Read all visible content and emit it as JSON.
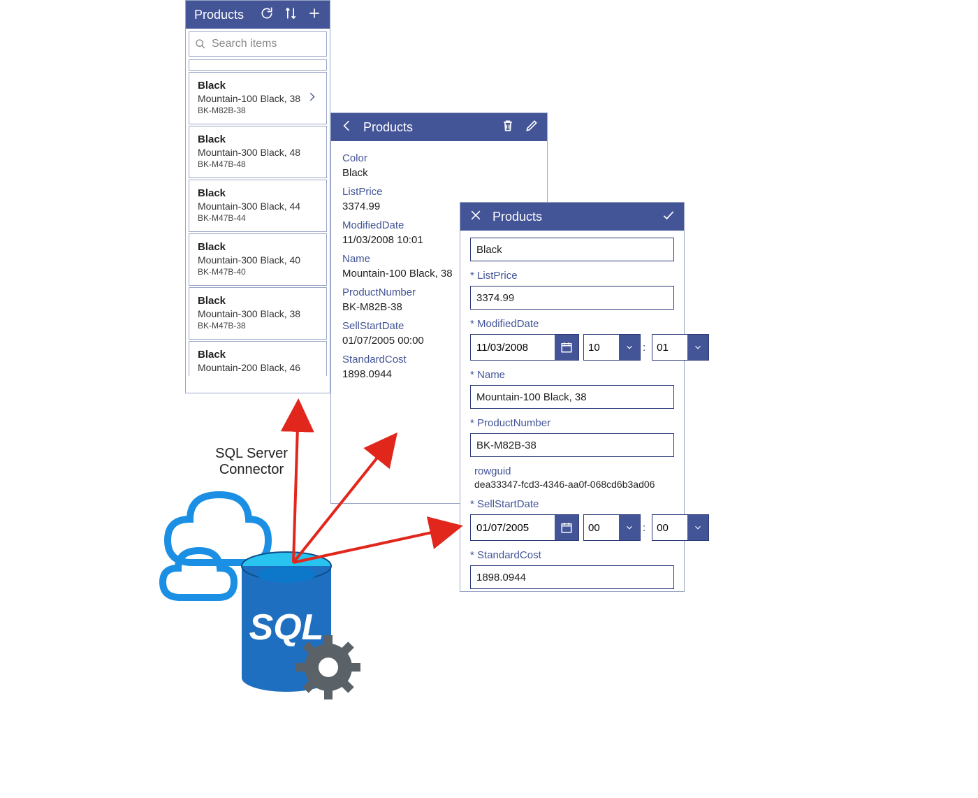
{
  "diagramLabel": {
    "line1": "SQL Server",
    "line2": "Connector"
  },
  "sqlText": "SQL",
  "listPanel": {
    "title": "Products",
    "searchPlaceholder": "Search items",
    "items": [
      {
        "color": "Black",
        "name": "Mountain-100 Black, 38",
        "code": "BK-M82B-38",
        "selected": true
      },
      {
        "color": "Black",
        "name": "Mountain-300 Black, 48",
        "code": "BK-M47B-48"
      },
      {
        "color": "Black",
        "name": "Mountain-300 Black, 44",
        "code": "BK-M47B-44"
      },
      {
        "color": "Black",
        "name": "Mountain-300 Black, 40",
        "code": "BK-M47B-40"
      },
      {
        "color": "Black",
        "name": "Mountain-300 Black, 38",
        "code": "BK-M47B-38"
      },
      {
        "color": "Black",
        "name": "Mountain-200 Black, 46",
        "code": ""
      }
    ]
  },
  "detailPanel": {
    "title": "Products",
    "fields": {
      "color_label": "Color",
      "color_value": "Black",
      "listprice_label": "ListPrice",
      "listprice_value": "3374.99",
      "modifieddate_label": "ModifiedDate",
      "modifieddate_value": "11/03/2008 10:01",
      "name_label": "Name",
      "name_value": "Mountain-100 Black, 38",
      "productnumber_label": "ProductNumber",
      "productnumber_value": "BK-M82B-38",
      "sellstartdate_label": "SellStartDate",
      "sellstartdate_value": "01/07/2005 00:00",
      "standardcost_label": "StandardCost",
      "standardcost_value": "1898.0944"
    }
  },
  "editPanel": {
    "title": "Products",
    "colorValue": "Black",
    "fields": {
      "listprice_label": "ListPrice",
      "listprice_value": "3374.99",
      "modifieddate_label": "ModifiedDate",
      "modifieddate_date": "11/03/2008",
      "modifieddate_h": "10",
      "modifieddate_m": "01",
      "name_label": "Name",
      "name_value": "Mountain-100 Black, 38",
      "productnumber_label": "ProductNumber",
      "productnumber_value": "BK-M82B-38",
      "rowguid_label": "rowguid",
      "rowguid_value": "dea33347-fcd3-4346-aa0f-068cd6b3ad06",
      "sellstartdate_label": "SellStartDate",
      "sellstartdate_date": "01/07/2005",
      "sellstartdate_h": "00",
      "sellstartdate_m": "00",
      "standardcost_label": "StandardCost",
      "standardcost_value": "1898.0944"
    }
  }
}
